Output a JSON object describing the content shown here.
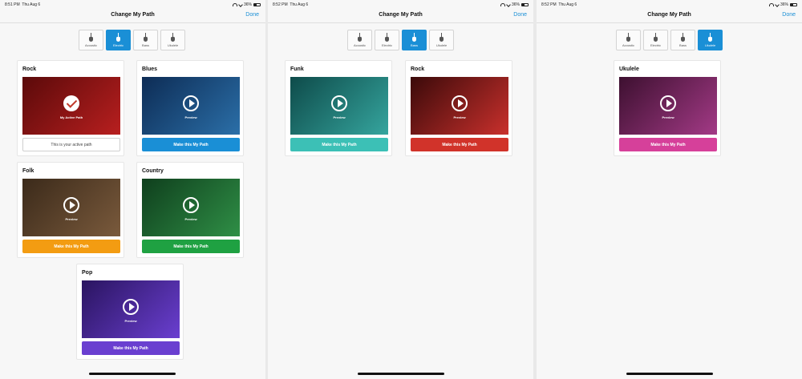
{
  "panels": [
    {
      "status": {
        "time": "8:51 PM",
        "date": "Thu Aug 6",
        "battery": "36%"
      },
      "nav": {
        "title": "Change My Path",
        "done": "Done"
      },
      "tabs": [
        "Acoustic",
        "Electric",
        "Bass",
        "Ukulele"
      ],
      "active_tab": "Electric",
      "cards": [
        {
          "title": "Rock",
          "thumb_label": "My Active Path",
          "status_text": "This is your active path",
          "active": true,
          "color": "#b81f1f",
          "thumb_bg": [
            "#5b0a0a",
            "#b81f1f"
          ]
        },
        {
          "title": "Blues",
          "thumb_label": "Preview",
          "cta": "Make this My Path",
          "color": "#1a8fd6",
          "thumb_bg": [
            "#0d2c55",
            "#2b6fa8"
          ]
        },
        {
          "title": "Folk",
          "thumb_label": "Preview",
          "cta": "Make this My Path",
          "color": "#f39c12",
          "thumb_bg": [
            "#3b2a1a",
            "#7a5a3c"
          ]
        },
        {
          "title": "Country",
          "thumb_label": "Preview",
          "cta": "Make this My Path",
          "color": "#1fa142",
          "thumb_bg": [
            "#0f3f1d",
            "#2f8f46"
          ]
        },
        {
          "title": "Pop",
          "thumb_label": "Preview",
          "cta": "Make this My Path",
          "color": "#6a3fd0",
          "thumb_bg": [
            "#2a1460",
            "#6a3fd0"
          ]
        }
      ]
    },
    {
      "status": {
        "time": "8:52 PM",
        "date": "Thu Aug 6",
        "battery": "36%"
      },
      "nav": {
        "title": "Change My Path",
        "done": "Done"
      },
      "tabs": [
        "Acoustic",
        "Electric",
        "Bass",
        "Ukulele"
      ],
      "active_tab": "Bass",
      "cards": [
        {
          "title": "Funk",
          "thumb_label": "Preview",
          "cta": "Make this My Path",
          "color": "#3cc0b6",
          "thumb_bg": [
            "#0e4b4a",
            "#35a59e"
          ]
        },
        {
          "title": "Rock",
          "thumb_label": "Preview",
          "cta": "Make this My Path",
          "color": "#d1332a",
          "thumb_bg": [
            "#3b0a0a",
            "#c9302c"
          ]
        }
      ]
    },
    {
      "status": {
        "time": "8:52 PM",
        "date": "Thu Aug 6",
        "battery": "36%"
      },
      "nav": {
        "title": "Change My Path",
        "done": "Done"
      },
      "tabs": [
        "Acoustic",
        "Electric",
        "Bass",
        "Ukulele"
      ],
      "active_tab": "Ukulele",
      "cards": [
        {
          "title": "Ukulele",
          "thumb_label": "Preview",
          "cta": "Make this My Path",
          "color": "#d6409a",
          "thumb_bg": [
            "#3d1030",
            "#a33a86"
          ]
        }
      ]
    }
  ]
}
